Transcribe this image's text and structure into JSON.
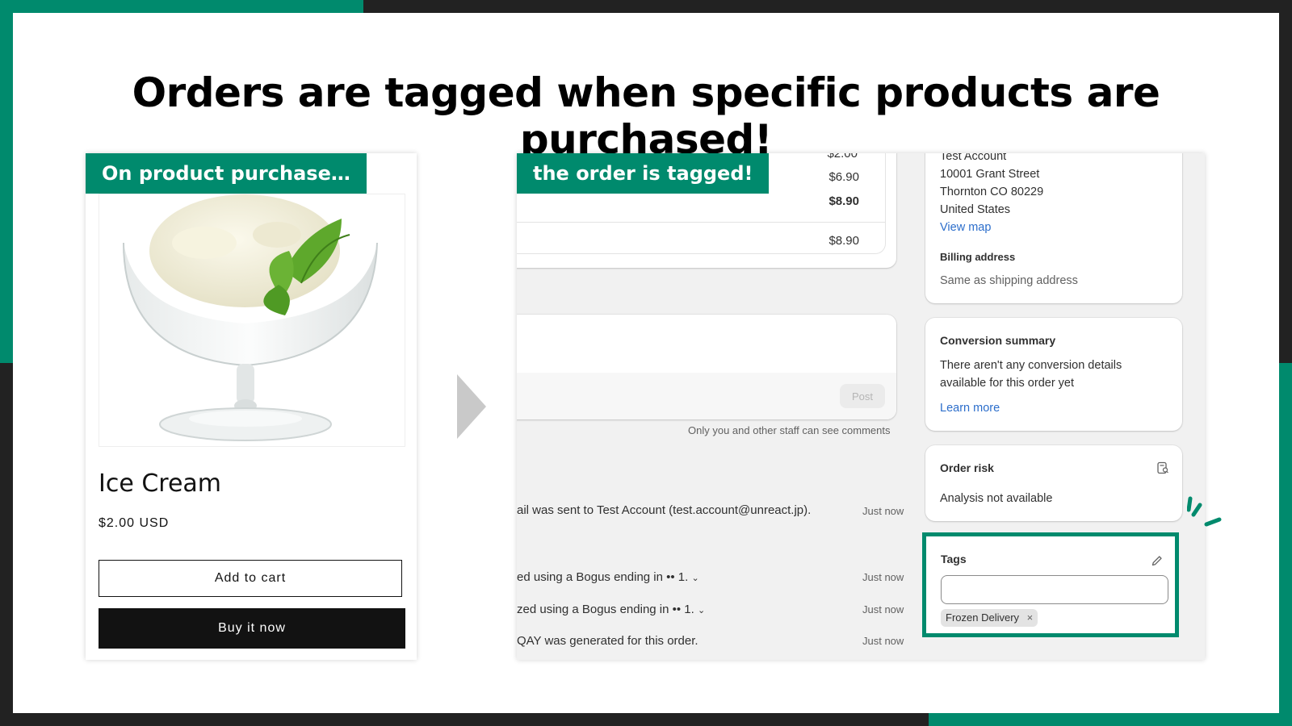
{
  "brand_color": "#008a6d",
  "background_color": "#222222",
  "headline": "Orders are tagged when specific products are purchased!",
  "product_card": {
    "banner": "On product purchase…",
    "image_icon": "ice-cream-sundae",
    "name": "Ice Cream",
    "price": "$2.00 USD",
    "add_to_cart": "Add to cart",
    "buy_now": "Buy it now"
  },
  "arrow_icon": "chevron-right-arrow",
  "order_admin": {
    "banner": "the order is tagged!",
    "summary": {
      "partial_amount": "$2.00",
      "amount_1": "$6.90",
      "total": "$8.90",
      "paid": "$8.90"
    },
    "comment": {
      "post_button": "Post",
      "note": "Only you and other staff can see comments"
    },
    "timeline": [
      {
        "text": "ail was sent to Test Account (test.account@unreact.jp).",
        "time": "Just now"
      },
      {
        "text": "ed using a Bogus ending in •• 1.",
        "time": "Just now"
      },
      {
        "text": "zed using a Bogus ending in •• 1.",
        "time": "Just now"
      },
      {
        "text": "QAY was generated for this order.",
        "time": "Just now"
      }
    ],
    "shipping": {
      "name": "Test Account",
      "street": "10001 Grant Street",
      "city": "Thornton CO 80229",
      "country": "United States",
      "view_map": "View map",
      "billing_heading": "Billing address",
      "billing_value": "Same as shipping address"
    },
    "conversion": {
      "heading": "Conversion summary",
      "line1": "There aren't any conversion details",
      "line2": "available for this order yet",
      "learn_more": "Learn more"
    },
    "risk": {
      "heading": "Order risk",
      "value": "Analysis not available"
    },
    "tags": {
      "heading": "Tags",
      "input_value": "",
      "chip": "Frozen Delivery"
    }
  }
}
